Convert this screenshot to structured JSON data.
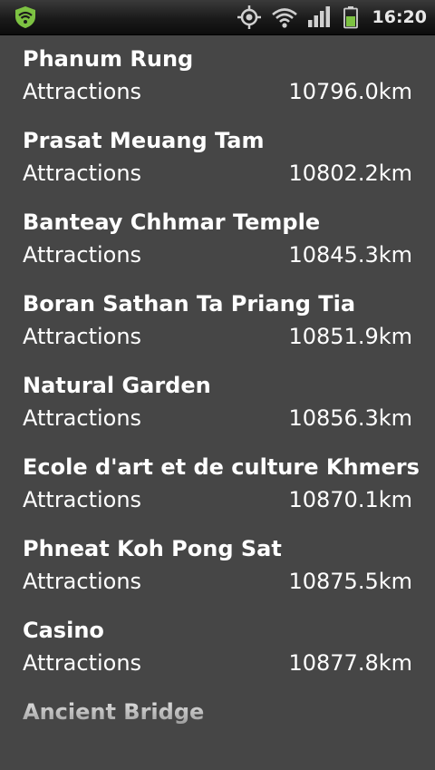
{
  "status_bar": {
    "time": "16:20",
    "icons": [
      "shield-wifi-icon",
      "gps-icon",
      "wifi-icon",
      "signal-icon",
      "battery-icon"
    ],
    "accent": "#7dc242"
  },
  "places": [
    {
      "name": "Phanum Rung",
      "category": "Attractions",
      "distance": "10796.0km"
    },
    {
      "name": "Prasat Meuang Tam",
      "category": "Attractions",
      "distance": "10802.2km"
    },
    {
      "name": "Banteay Chhmar Temple",
      "category": "Attractions",
      "distance": "10845.3km"
    },
    {
      "name": "Boran Sathan Ta Priang Tia",
      "category": "Attractions",
      "distance": "10851.9km"
    },
    {
      "name": "Natural Garden",
      "category": "Attractions",
      "distance": "10856.3km"
    },
    {
      "name": "Ecole d'art et de culture Khmers",
      "category": "Attractions",
      "distance": "10870.1km"
    },
    {
      "name": "Phneat Koh Pong Sat",
      "category": "Attractions",
      "distance": "10875.5km"
    },
    {
      "name": "Casino",
      "category": "Attractions",
      "distance": "10877.8km"
    },
    {
      "name": "Ancient Bridge"
    }
  ],
  "colors": {
    "background": "#464646",
    "text": "#ffffff"
  }
}
